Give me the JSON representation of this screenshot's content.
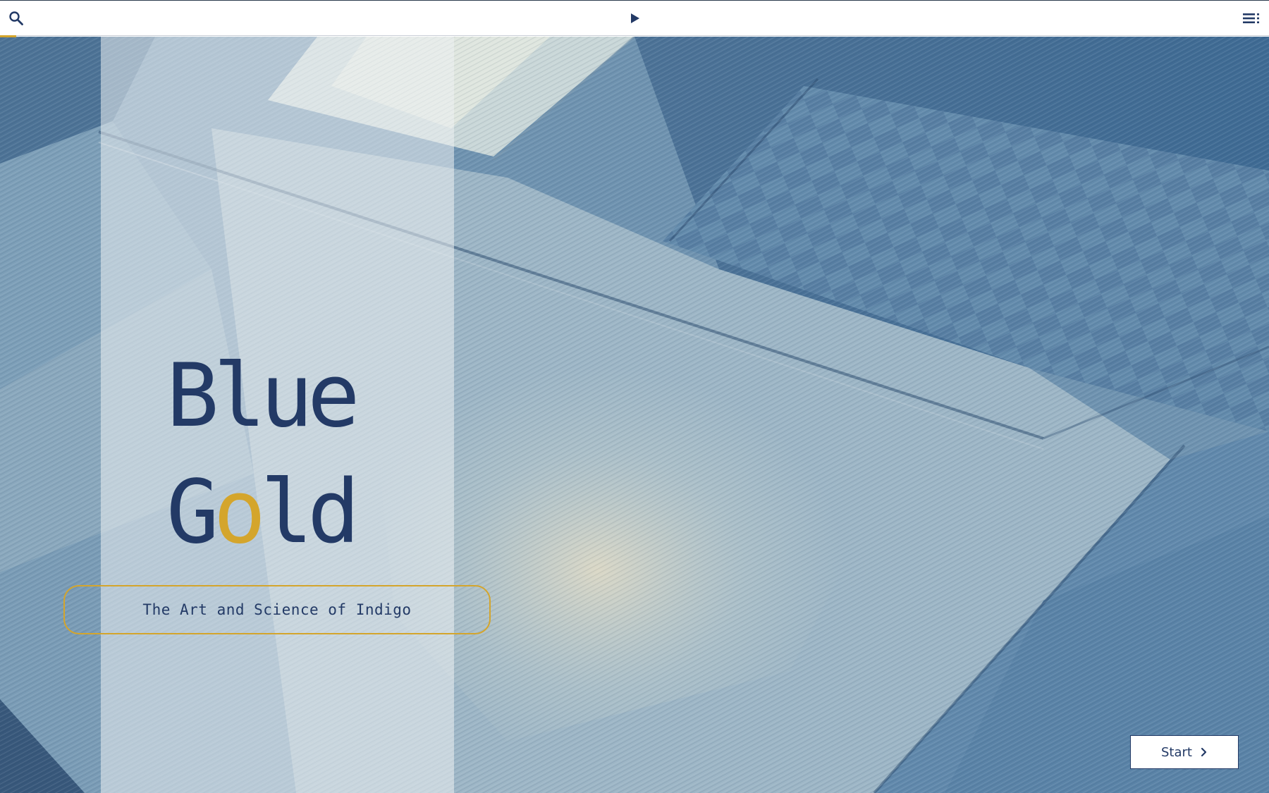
{
  "toolbar": {
    "search_icon": "search-icon",
    "play_icon": "play-icon",
    "menu_icon": "menu-list-icon",
    "progress_fraction": 0.013
  },
  "hero": {
    "background": "indigo-dyed patchwork fabric photo",
    "title_line_1": [
      "B",
      "l",
      "u",
      "e"
    ],
    "title_line_2": [
      "G",
      "o",
      "l",
      "d"
    ],
    "subtitle": "The Art and Science of Indigo",
    "start_label": "Start",
    "start_icon": "chevron-right-icon"
  },
  "colors": {
    "navy": "#233a66",
    "gold": "#d4a52c",
    "panel": "#ecf0f3"
  }
}
